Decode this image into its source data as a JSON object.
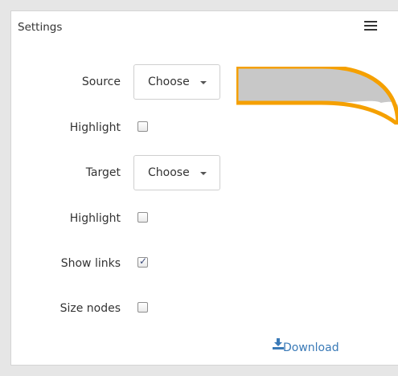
{
  "panel": {
    "title": "Settings"
  },
  "icons": {
    "menu": "hamburger-menu-icon",
    "download": "download-icon"
  },
  "rows": [
    {
      "label": "Source",
      "control": "select",
      "value": "Choose"
    },
    {
      "label": "Highlight",
      "control": "checkbox",
      "checked": false
    },
    {
      "label": "Target",
      "control": "select",
      "value": "Choose"
    },
    {
      "label": "Highlight",
      "control": "checkbox",
      "checked": false
    },
    {
      "label": "Show links",
      "control": "checkbox",
      "checked": true
    },
    {
      "label": "Size nodes",
      "control": "checkbox",
      "checked": false
    }
  ],
  "download": {
    "label": "Download"
  },
  "colors": {
    "link": "#3a7ab7",
    "graph_fill": "#c8c8c8",
    "graph_stroke": "#f5a000"
  }
}
